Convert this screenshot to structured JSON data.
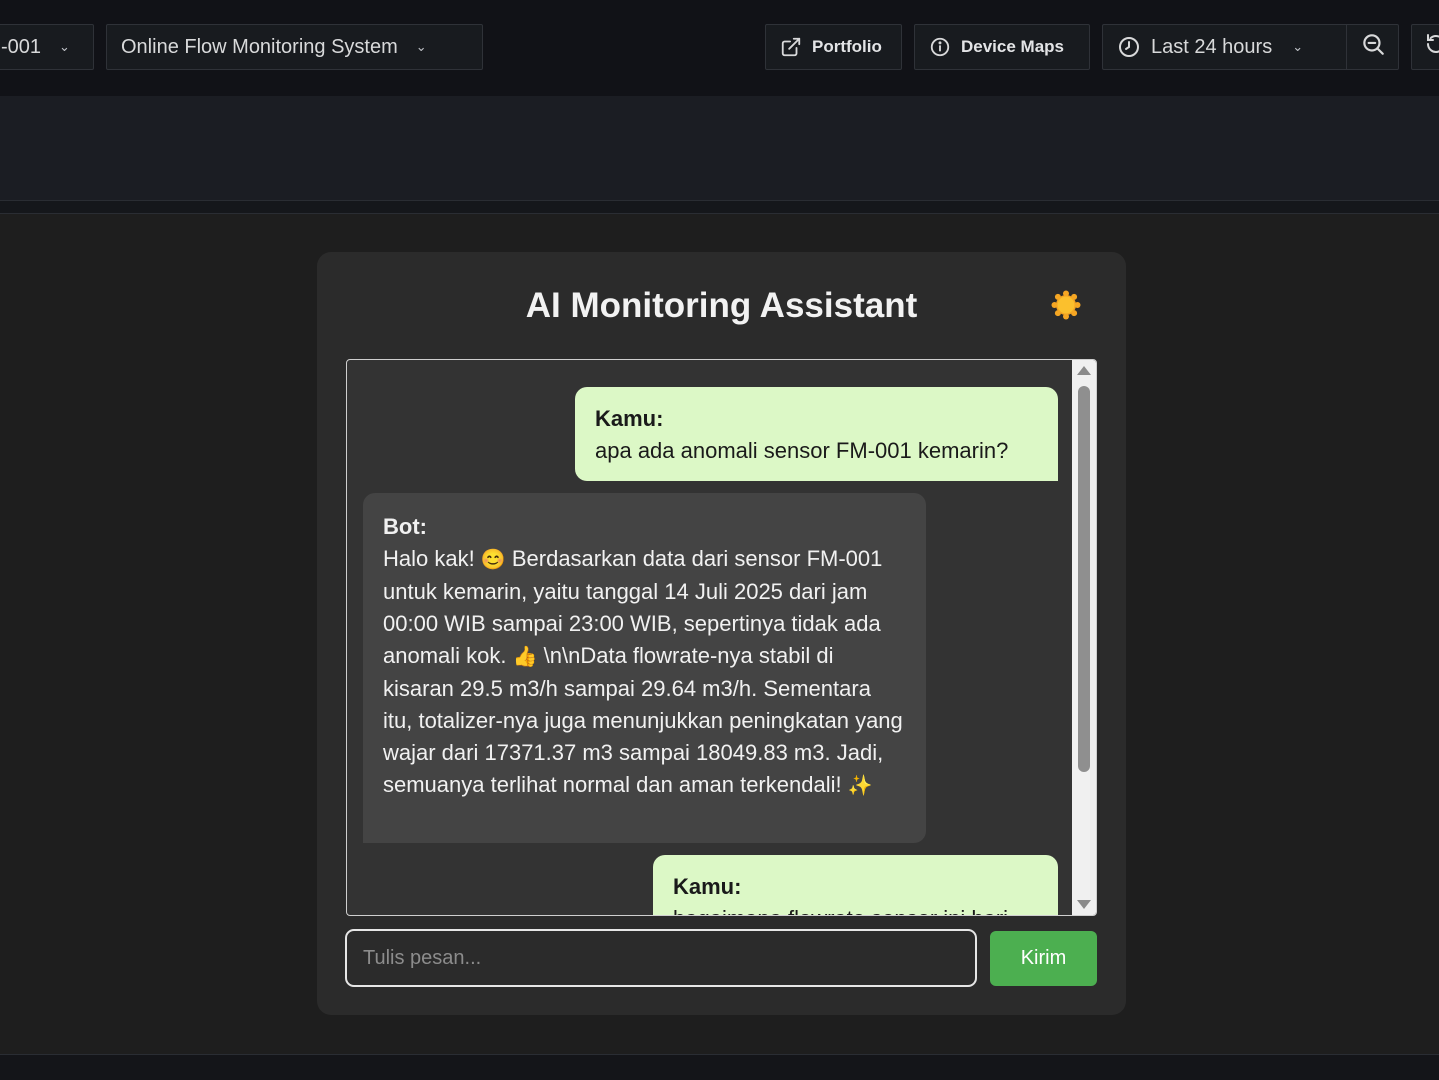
{
  "toolbar": {
    "device_variable": "-001",
    "dashboard_title": "Online Flow Monitoring System",
    "portfolio_label": "Portfolio",
    "device_maps_label": "Device Maps",
    "time_range": "Last 24 hours"
  },
  "chat": {
    "title": "AI Monitoring Assistant",
    "theme_icon": "sun-icon",
    "messages": [
      {
        "sender": "Kamu:",
        "text": "apa ada anomali sensor FM-001 kemarin?"
      },
      {
        "sender": "Bot:",
        "text_part1": "Halo kak! ",
        "emoji1": "😊",
        "text_part2": " Berdasarkan data dari sensor FM-001 untuk kemarin, yaitu tanggal 14 Juli 2025 dari jam 00:00 WIB sampai 23:00 WIB, sepertinya tidak ada anomali kok. ",
        "emoji2": "👍",
        "text_part3": " \\n\\nData flowrate-nya stabil di kisaran 29.5 m3/h sampai 29.64 m3/h. Sementara itu, totalizer-nya juga menunjukkan peningkatan yang wajar dari 17371.37 m3 sampai 18049.83 m3. Jadi, semuanya terlihat normal dan aman terkendali! ",
        "emoji3": "✨"
      },
      {
        "sender": "Kamu:",
        "text": "bagaimana flowrate sensor ini hari ini?"
      }
    ],
    "input_placeholder": "Tulis pesan...",
    "send_label": "Kirim"
  },
  "colors": {
    "user_bubble": "#dcf8c6",
    "bot_bubble": "#444444",
    "send_button": "#4caf50"
  }
}
